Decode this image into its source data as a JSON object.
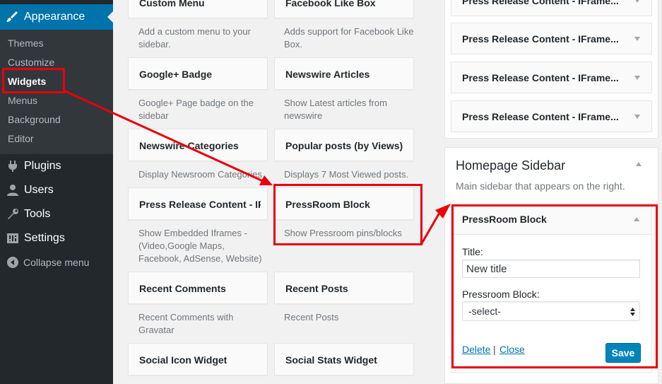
{
  "admin_menu": {
    "current_section": "Appearance",
    "submenu": [
      "Themes",
      "Customize",
      "Widgets",
      "Menus",
      "Background",
      "Editor"
    ],
    "current_submenu": "Widgets",
    "items": [
      {
        "label": "Plugins",
        "icon": "plugin-icon"
      },
      {
        "label": "Users",
        "icon": "users-icon"
      },
      {
        "label": "Tools",
        "icon": "tools-icon"
      },
      {
        "label": "Settings",
        "icon": "settings-icon"
      }
    ],
    "collapse": "Collapse menu"
  },
  "widgets": [
    {
      "title": "Custom Menu",
      "desc": "Add a custom menu to your sidebar."
    },
    {
      "title": "Facebook Like Box",
      "desc": "Adds support for Facebook Like Box."
    },
    {
      "title": "Google+ Badge",
      "desc": "Google+ Page badge on the sidebar"
    },
    {
      "title": "Newswire Articles",
      "desc": "Show Latest articles from newswire"
    },
    {
      "title": "Newswire Categories",
      "desc": "Display Newsroom Categories"
    },
    {
      "title": "Popular posts (by Views)",
      "desc": "Displays 7 Most Viewed posts."
    },
    {
      "title": "Press Release Content - IFrame...",
      "desc": "Show Embedded Iframes - (Video,Google Maps, Facebook, AdSense, Website)"
    },
    {
      "title": "PressRoom Block",
      "desc": "Show Pressroom pins/blocks"
    },
    {
      "title": "Recent Comments",
      "desc": "Recent Comments with Gravatar"
    },
    {
      "title": "Recent Posts",
      "desc": "Recent Posts"
    },
    {
      "title": "Social Icon Widget",
      "desc": ""
    },
    {
      "title": "Social Stats Widget",
      "desc": ""
    }
  ],
  "upper_sidebar": {
    "widgets": [
      "Press Release Content - IFrame...",
      "Press Release Content - IFrame...",
      "Press Release Content - IFrame...",
      "Press Release Content - IFrame..."
    ]
  },
  "homepage_sidebar": {
    "title": "Homepage Sidebar",
    "description": "Main sidebar that appears on the right.",
    "open_widget": {
      "title": "PressRoom Block",
      "title_label": "Title:",
      "title_value": "New title",
      "block_label": "Pressroom Block:",
      "block_value": "-select-",
      "delete_label": "Delete",
      "separator": "|",
      "close_label": "Close",
      "save_label": "Save"
    }
  },
  "colors": {
    "admin_bg": "#23282d",
    "submenu_bg": "#32373c",
    "accent": "#0073aa",
    "save_button": "#0085ba",
    "annotation": "#e8000b"
  }
}
